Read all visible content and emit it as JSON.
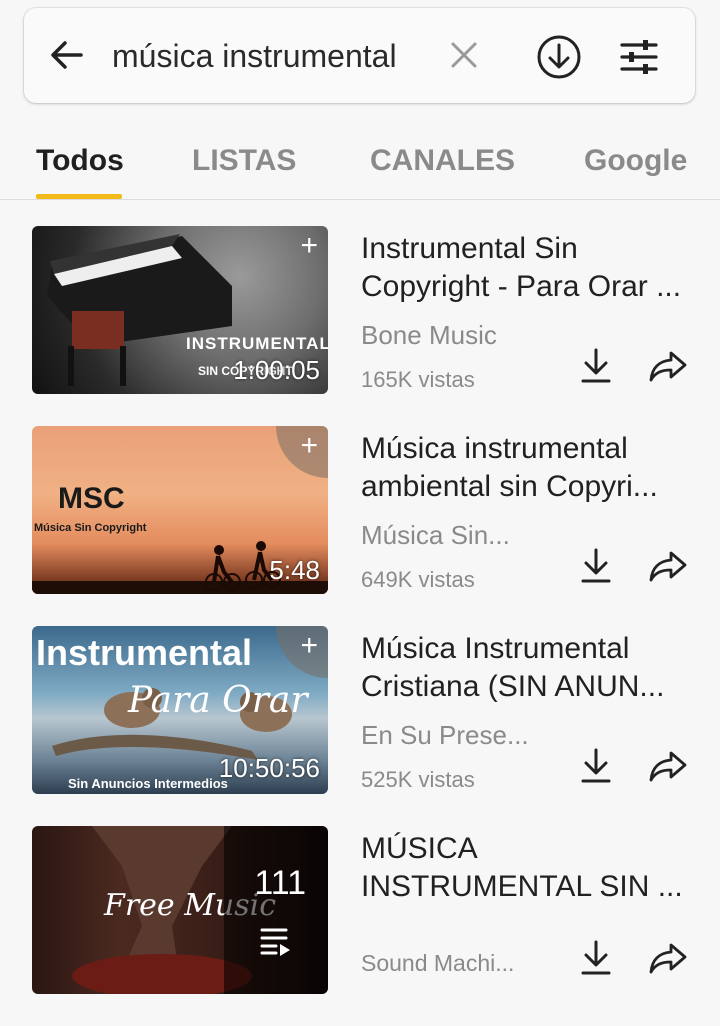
{
  "search": {
    "query": "música instrumental"
  },
  "tabs": [
    {
      "label": "Todos",
      "active": true
    },
    {
      "label": "LISTAS",
      "active": false
    },
    {
      "label": "CANALES",
      "active": false
    },
    {
      "label": "Google",
      "active": false
    }
  ],
  "results": [
    {
      "title_line1": "Instrumental Sin",
      "title_line2": "Copyright - Para Orar ...",
      "channel": "Bone Music",
      "views": "165K vistas",
      "duration": "1:00:05",
      "thumb_text1": "INSTRUMENTAL",
      "thumb_text2": "SIN COPYRIGHT"
    },
    {
      "title_line1": "Música instrumental",
      "title_line2": "ambiental sin Copyri...",
      "channel": "Música Sin...",
      "views": "649K vistas",
      "duration": "5:48",
      "thumb_text1": "MSC",
      "thumb_text2": "Música Sin Copyright"
    },
    {
      "title_line1": "Música Instrumental",
      "title_line2": "Cristiana (SIN ANUN...",
      "channel": "En Su Prese...",
      "views": "525K vistas",
      "duration": "10:50:56",
      "thumb_text1": "Instrumental",
      "thumb_text2": "Para Orar",
      "thumb_text3": "Sin Anuncios Intermedios"
    },
    {
      "title_line1": "MÚSICA",
      "title_line2": "INSTRUMENTAL SIN ...",
      "channel": "Sound Machi...",
      "playlist_count": "111",
      "thumb_text1": "Free Music"
    }
  ],
  "colors": {
    "accent": "#f2bb1a",
    "background": "#f7f7f7",
    "muted_text": "#8a8a8a"
  },
  "icons": {
    "back": "arrow-left-icon",
    "clear": "close-icon",
    "download": "download-circle-icon",
    "filter": "sliders-icon",
    "item_download": "download-icon",
    "item_share": "share-icon",
    "add": "plus-icon",
    "playlist": "playlist-icon"
  }
}
